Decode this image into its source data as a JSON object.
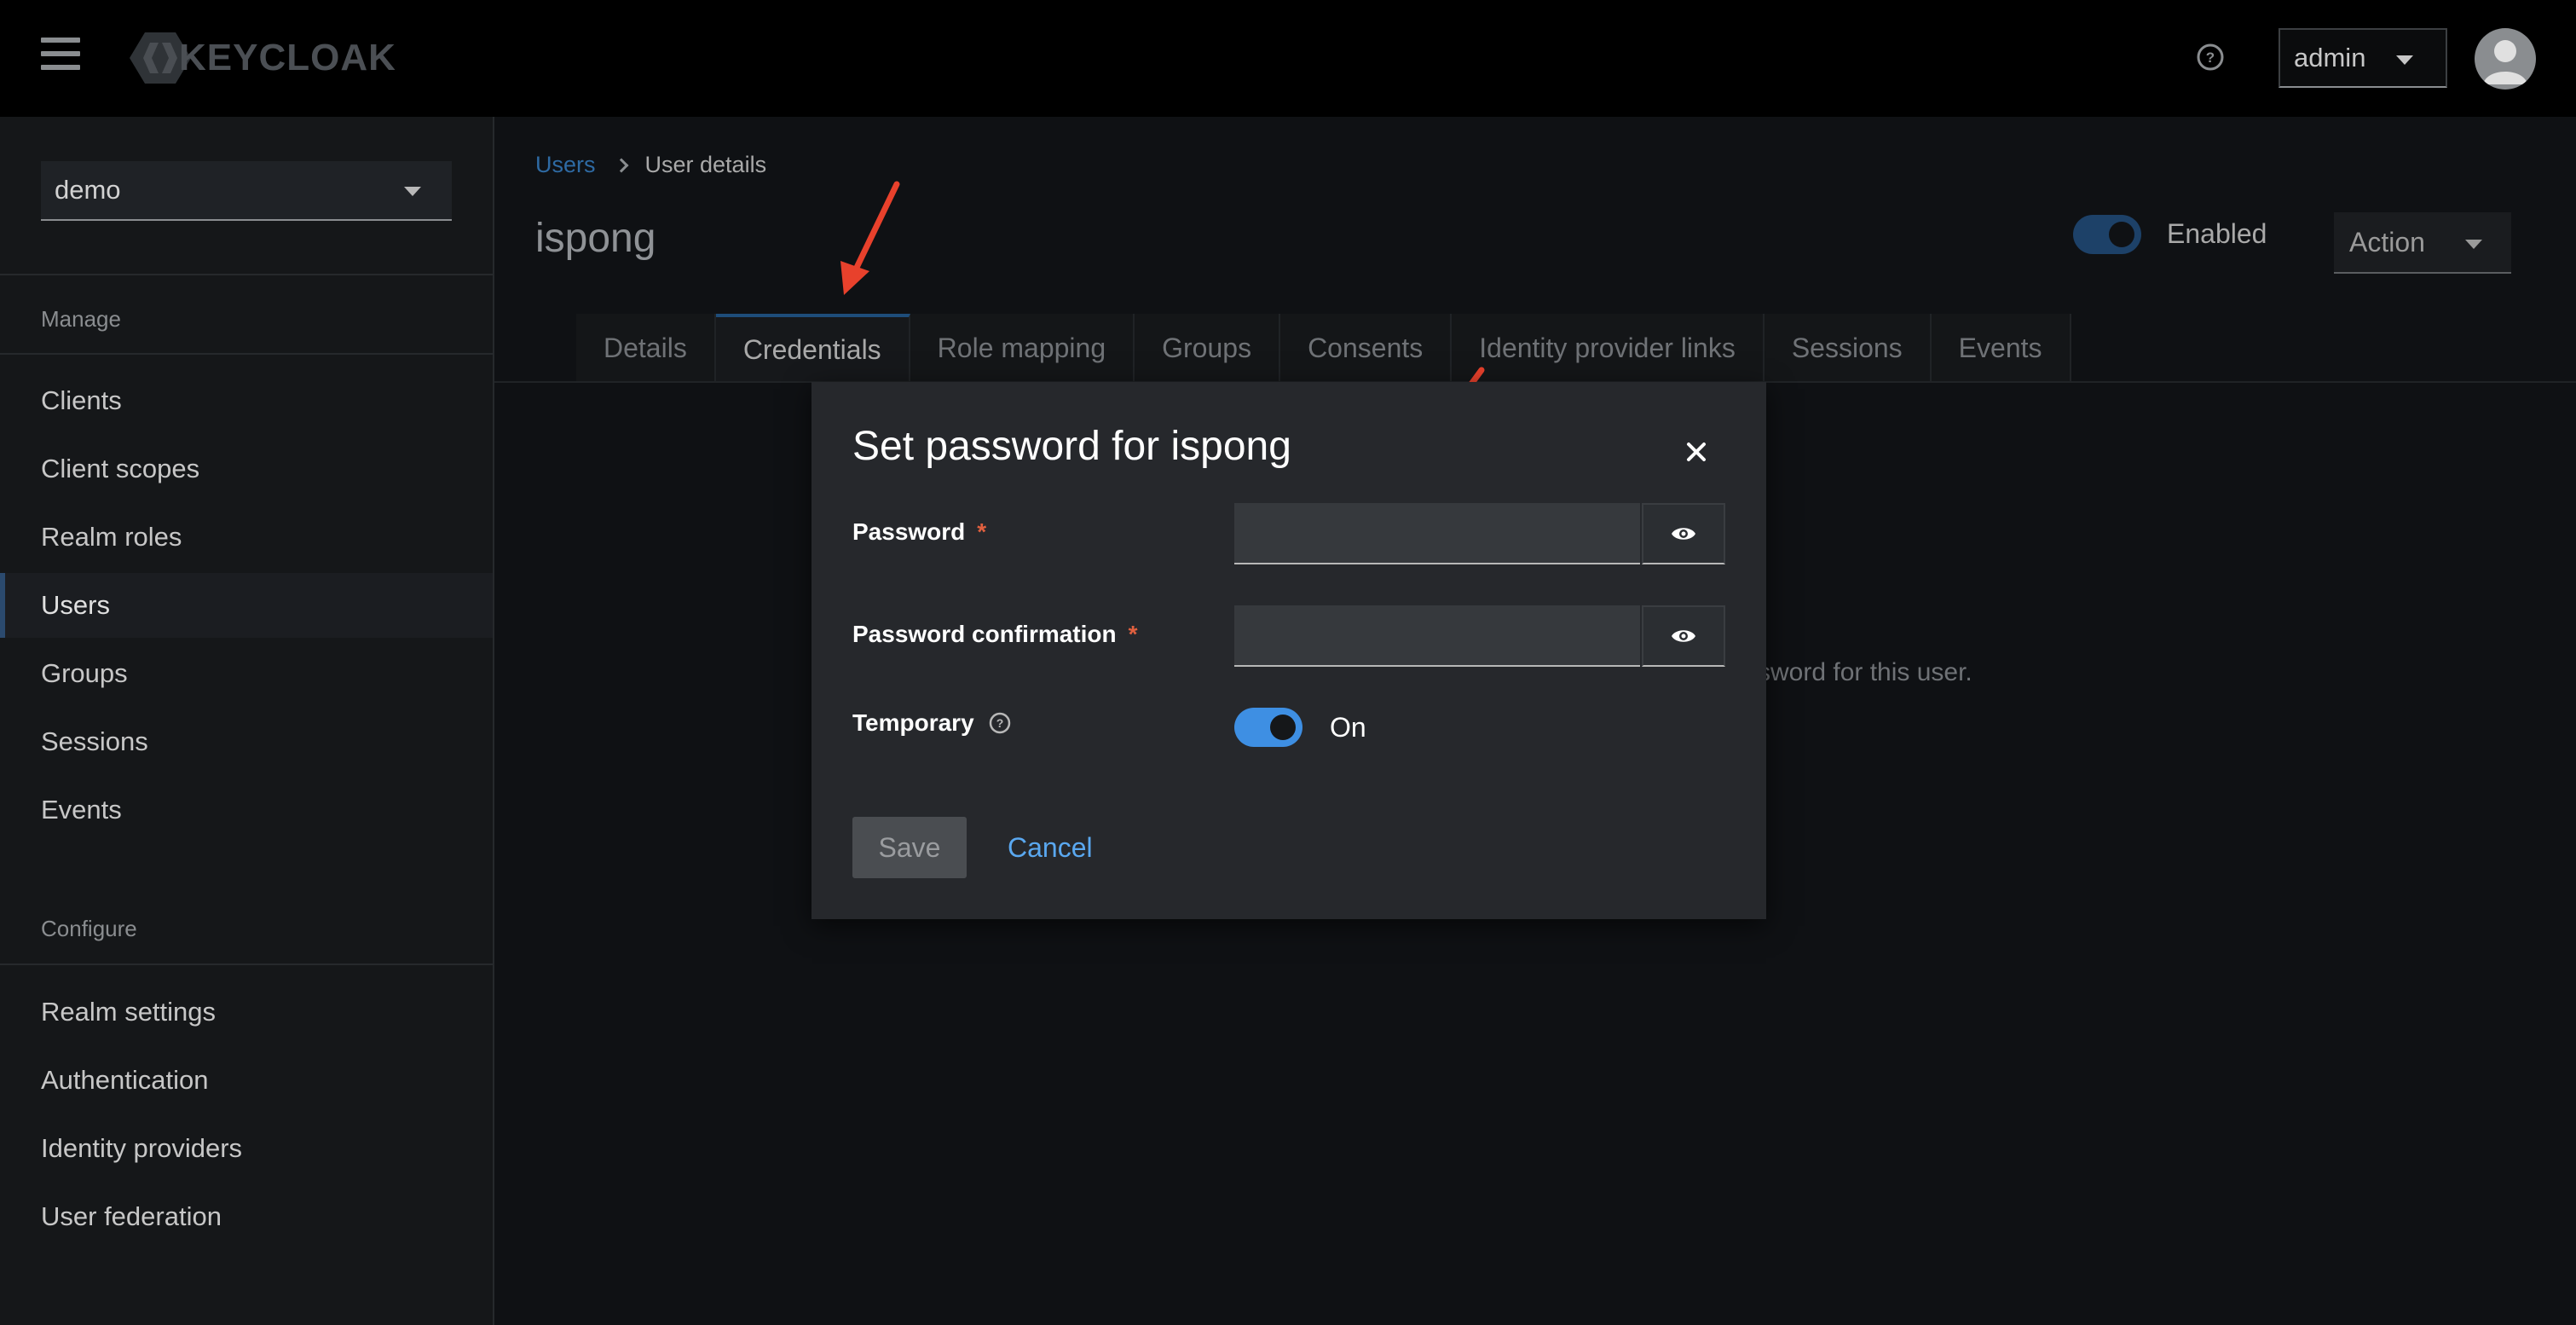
{
  "header": {
    "logo_text": "KEYCLOAK",
    "user_menu_label": "admin"
  },
  "sidebar": {
    "realm": "demo",
    "sections": [
      {
        "title": "Manage",
        "items": [
          {
            "label": "Clients"
          },
          {
            "label": "Client scopes"
          },
          {
            "label": "Realm roles"
          },
          {
            "label": "Users",
            "active": true
          },
          {
            "label": "Groups"
          },
          {
            "label": "Sessions"
          },
          {
            "label": "Events"
          }
        ]
      },
      {
        "title": "Configure",
        "items": [
          {
            "label": "Realm settings"
          },
          {
            "label": "Authentication"
          },
          {
            "label": "Identity providers"
          },
          {
            "label": "User federation"
          }
        ]
      }
    ]
  },
  "breadcrumb": {
    "parent": "Users",
    "current": "User details"
  },
  "page": {
    "title": "ispong",
    "enabled_label": "Enabled",
    "enabled": true,
    "action_label": "Action",
    "background_text": "sword for this user."
  },
  "tabs": [
    {
      "label": "Details"
    },
    {
      "label": "Credentials",
      "active": true
    },
    {
      "label": "Role mapping"
    },
    {
      "label": "Groups"
    },
    {
      "label": "Consents"
    },
    {
      "label": "Identity provider links"
    },
    {
      "label": "Sessions"
    },
    {
      "label": "Events"
    }
  ],
  "modal": {
    "title": "Set password for ispong",
    "password_label": "Password",
    "password_value": "",
    "confirmation_label": "Password confirmation",
    "confirmation_value": "",
    "required_mark": "*",
    "temporary_label": "Temporary",
    "temporary_state": "On",
    "temporary_on": true,
    "save_label": "Save",
    "cancel_label": "Cancel"
  },
  "colors": {
    "accent_link": "#5aa8f0",
    "toggle_on": "#3e8fe3",
    "required": "#e0603f",
    "annotation_arrow": "#e8412c"
  }
}
